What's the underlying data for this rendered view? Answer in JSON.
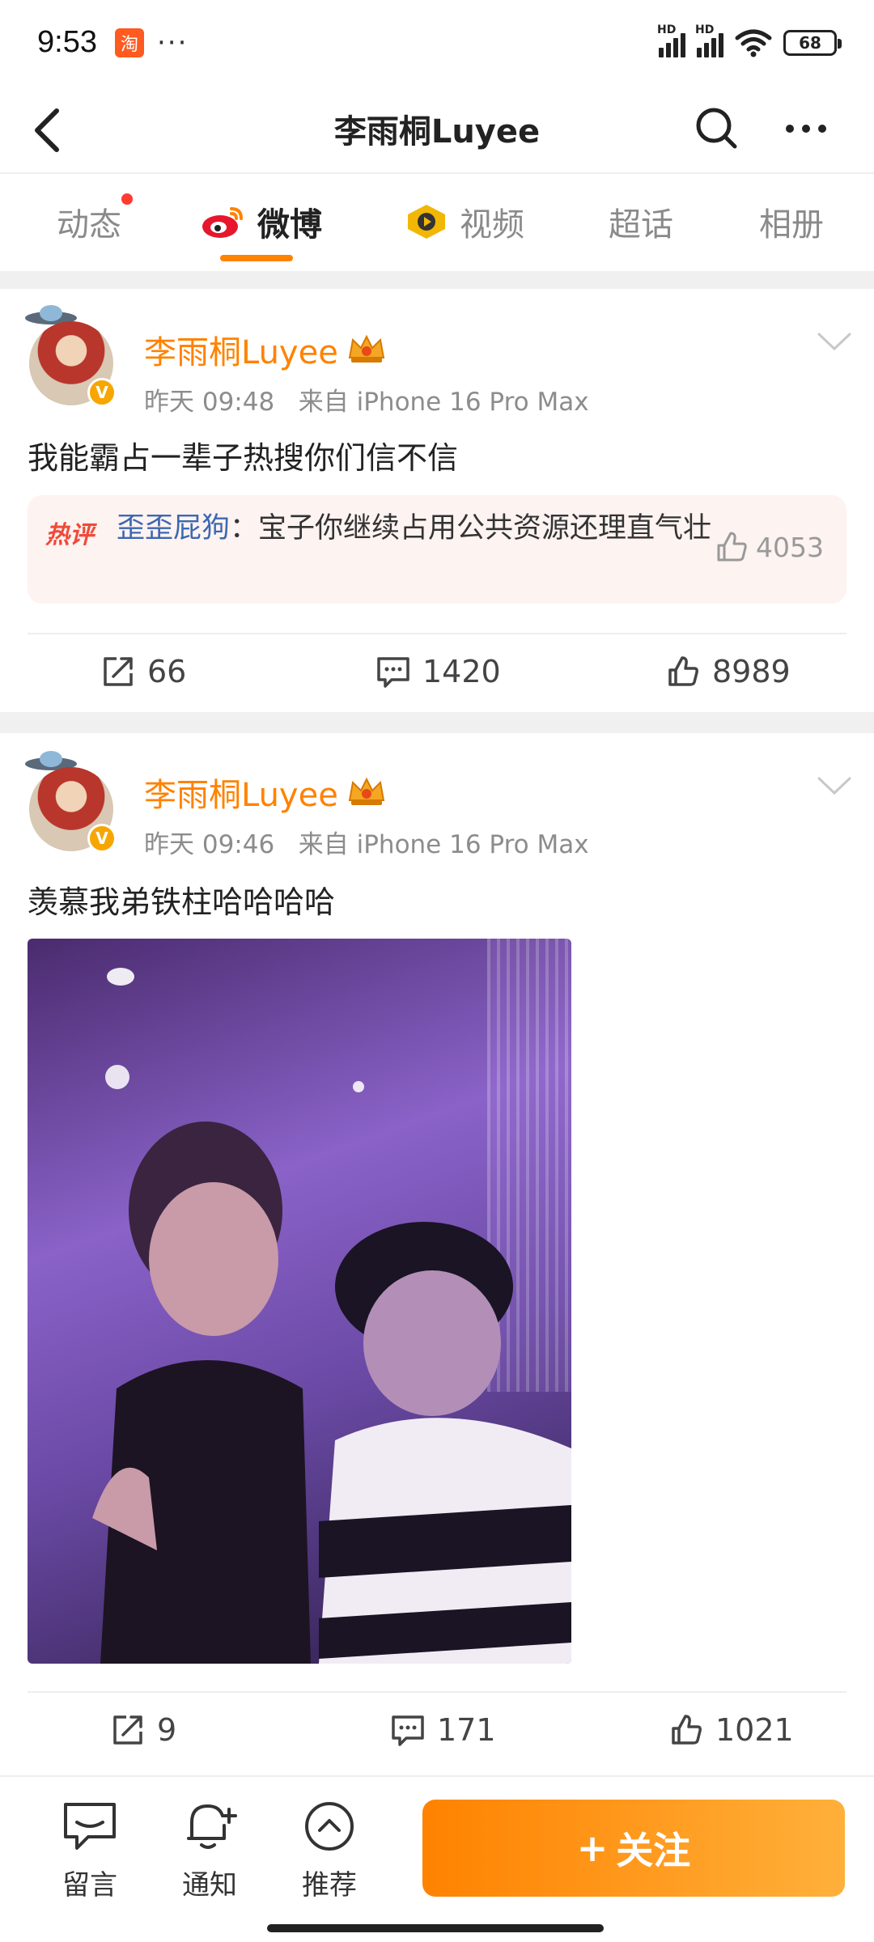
{
  "status_bar": {
    "time": "9:53",
    "app_icon": "taobao-icon",
    "app_icon_text": "淘",
    "more": "···",
    "signal_labels": [
      "HD",
      "HD"
    ],
    "battery": "68"
  },
  "nav": {
    "title": "李雨桐Luyee",
    "icons": [
      "back-icon",
      "search-icon",
      "more-icon"
    ]
  },
  "tabs": [
    {
      "label": "动态",
      "has_dot": true
    },
    {
      "label": "微博",
      "active": true
    },
    {
      "label": "视频"
    },
    {
      "label": "超话"
    },
    {
      "label": "相册"
    }
  ],
  "posts": [
    {
      "username": "李雨桐Luyee",
      "time": "昨天 09:48",
      "source": "来自 iPhone 16 Pro Max",
      "text": "我能霸占一辈子热搜你们信不信",
      "hot_comment": {
        "tag": "热评",
        "user": "歪歪屁狗",
        "colon": "：",
        "text": "宝子你继续占用公共资源还理直气壮",
        "likes": "4053"
      },
      "reposts": "66",
      "comments": "1420",
      "likes": "8989"
    },
    {
      "username": "李雨桐Luyee",
      "time": "昨天 09:46",
      "source": "来自 iPhone 16 Pro Max",
      "text": "羡慕我弟铁柱哈哈哈哈",
      "reposts": "9",
      "comments": "171",
      "likes": "1021"
    }
  ],
  "bottom_bar": {
    "items": [
      {
        "label": "留言",
        "icon": "message-icon"
      },
      {
        "label": "通知",
        "icon": "bell-icon"
      },
      {
        "label": "推荐",
        "icon": "recommend-icon"
      }
    ],
    "follow_plus": "+",
    "follow_label": "关注"
  },
  "colors": {
    "accent": "#ff8200",
    "hot_tag": "#f04a3a",
    "comment_user": "#3d68b0"
  }
}
